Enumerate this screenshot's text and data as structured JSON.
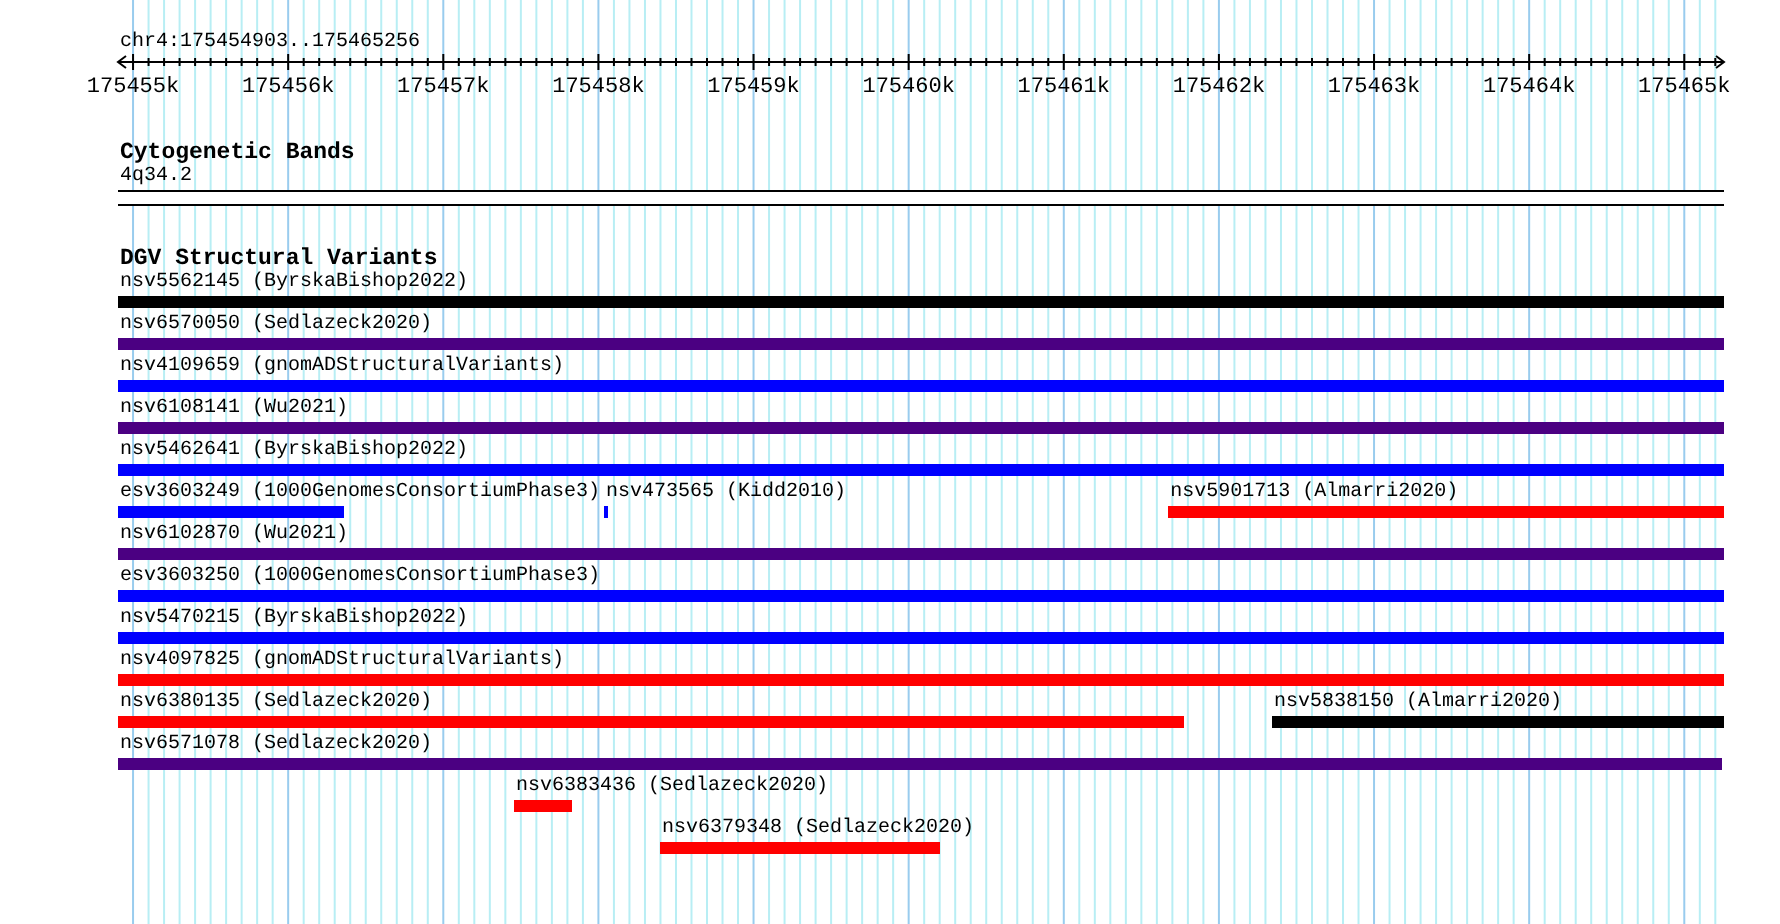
{
  "ruler": {
    "title": "chr4:175454903..175465256",
    "ticks": [
      "175455k",
      "175456k",
      "175457k",
      "175458k",
      "175459k",
      "175460k",
      "175461k",
      "175462k",
      "175463k",
      "175464k",
      "175465k"
    ]
  },
  "tracks": [
    {
      "kind": "cytoband",
      "title": "Cytogenetic Bands",
      "band": "4q34.2"
    },
    {
      "kind": "features",
      "title": "DGV Structural Variants",
      "rows": [
        {
          "features": [
            {
              "label": "nsv5562145 (ByrskaBishop2022)",
              "color": "#000000"
            }
          ]
        },
        {
          "features": [
            {
              "label": "nsv6570050 (Sedlazeck2020)",
              "color": "#4b0082"
            }
          ]
        },
        {
          "features": [
            {
              "label": "nsv4109659 (gnomADStructuralVariants)",
              "color": "#0000ff"
            }
          ]
        },
        {
          "features": [
            {
              "label": "nsv6108141 (Wu2021)",
              "color": "#4b0082"
            }
          ]
        },
        {
          "features": [
            {
              "label": "nsv5462641 (ByrskaBishop2022)",
              "color": "#0000ff"
            }
          ]
        },
        {
          "features": [
            {
              "label": "esv3603249 (1000GenomesConsortiumPhase3)",
              "color": "#0000ff"
            },
            {
              "label": "nsv473565 (Kidd2010)",
              "color": "#0000ff"
            },
            {
              "label": "nsv5901713 (Almarri2020)",
              "color": "#ff0000"
            }
          ]
        },
        {
          "features": [
            {
              "label": "nsv6102870 (Wu2021)",
              "color": "#4b0082"
            }
          ]
        },
        {
          "features": [
            {
              "label": "esv3603250 (1000GenomesConsortiumPhase3)",
              "color": "#0000ff"
            }
          ]
        },
        {
          "features": [
            {
              "label": "nsv5470215 (ByrskaBishop2022)",
              "color": "#0000ff"
            }
          ]
        },
        {
          "features": [
            {
              "label": "nsv4097825 (gnomADStructuralVariants)",
              "color": "#ff0000"
            }
          ]
        },
        {
          "features": [
            {
              "label": "nsv6380135 (Sedlazeck2020)",
              "color": "#ff0000"
            },
            {
              "label": "nsv5838150 (Almarri2020)",
              "color": "#000000"
            }
          ]
        },
        {
          "features": [
            {
              "label": "nsv6571078 (Sedlazeck2020)",
              "color": "#4b0082"
            }
          ]
        },
        {
          "features": [
            {
              "label": "nsv6383436 (Sedlazeck2020)",
              "color": "#ff0000"
            }
          ]
        },
        {
          "features": [
            {
              "label": "nsv6379348 (Sedlazeck2020)",
              "color": "#ff0000"
            }
          ]
        }
      ]
    }
  ]
}
